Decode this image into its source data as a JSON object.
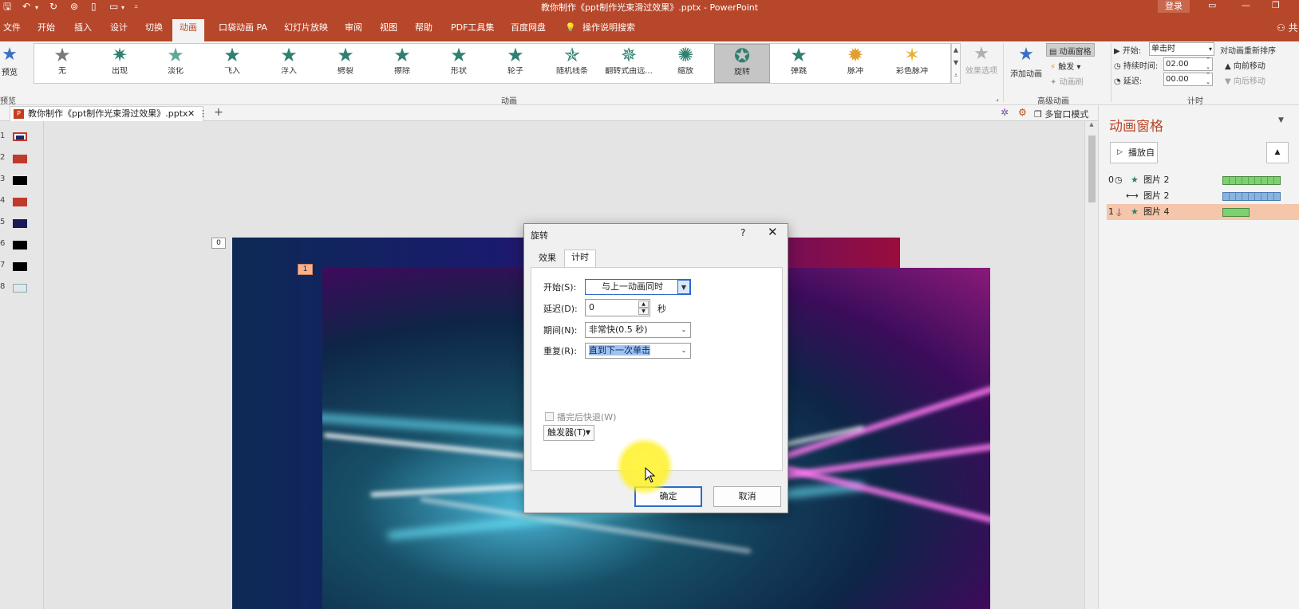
{
  "window": {
    "title": "教你制作《ppt制作光束滑过效果》.pptx - PowerPoint",
    "login": "登录"
  },
  "tabs": [
    "文件",
    "开始",
    "插入",
    "设计",
    "切换",
    "动画",
    "口袋动画 PA",
    "幻灯片放映",
    "审阅",
    "视图",
    "帮助",
    "PDF工具集",
    "百度网盘",
    "操作说明搜索"
  ],
  "ribbon": {
    "preview_label": "预览",
    "preview_group": "预览",
    "animations": [
      "无",
      "出现",
      "淡化",
      "飞入",
      "浮入",
      "劈裂",
      "擦除",
      "形状",
      "轮子",
      "随机线条",
      "翻转式由远...",
      "缩放",
      "旋转",
      "弹跳",
      "脉冲",
      "彩色脉冲"
    ],
    "effect_options": "效果选项",
    "animation_group": "动画",
    "add_animation": "添加动画",
    "animation_pane": "动画窗格",
    "trigger": "触发",
    "animation_brush": "动画刷",
    "advanced_group": "高级动画",
    "start_label": "开始:",
    "start_value": "单击时",
    "duration_label": "持续时间:",
    "duration_value": "02.00",
    "delay_label": "延迟:",
    "delay_value": "00.00",
    "reorder_label": "对动画重新排序",
    "move_earlier": "向前移动",
    "move_later": "向后移动",
    "timing_group": "计时"
  },
  "doc_tab": {
    "name": "教你制作《ppt制作光束滑过效果》.pptx",
    "multi_window": "多窗口模式"
  },
  "slides": [
    "1",
    "2",
    "3",
    "4",
    "5",
    "6",
    "7",
    "8"
  ],
  "slide_tags": {
    "back": "0",
    "front": "1"
  },
  "animation_pane": {
    "title": "动画窗格",
    "play_from": "播放自",
    "items": [
      {
        "index": "0",
        "name": "图片 2"
      },
      {
        "index": "",
        "name": "图片 2"
      },
      {
        "index": "1",
        "name": "图片 4"
      }
    ]
  },
  "dialog": {
    "title": "旋转",
    "help": "?",
    "tabs": [
      "效果",
      "计时"
    ],
    "start_label": "开始(S):",
    "start_value": "与上一动画同时",
    "delay_label": "延迟(D):",
    "delay_value": "0",
    "delay_unit": "秒",
    "duration_label": "期间(N):",
    "duration_value": "非常快(0.5 秒)",
    "repeat_label": "重复(R):",
    "repeat_value": "直到下一次单击",
    "rewind_label": "播完后快退(W)",
    "triggers_label": "触发器(T)",
    "ok": "确定",
    "cancel": "取消"
  },
  "colors": {
    "accent": "#b7472a",
    "ribbon": "#f3f3f3",
    "selected_row": "#f6c6ab",
    "anim_green": "#2f8070"
  }
}
